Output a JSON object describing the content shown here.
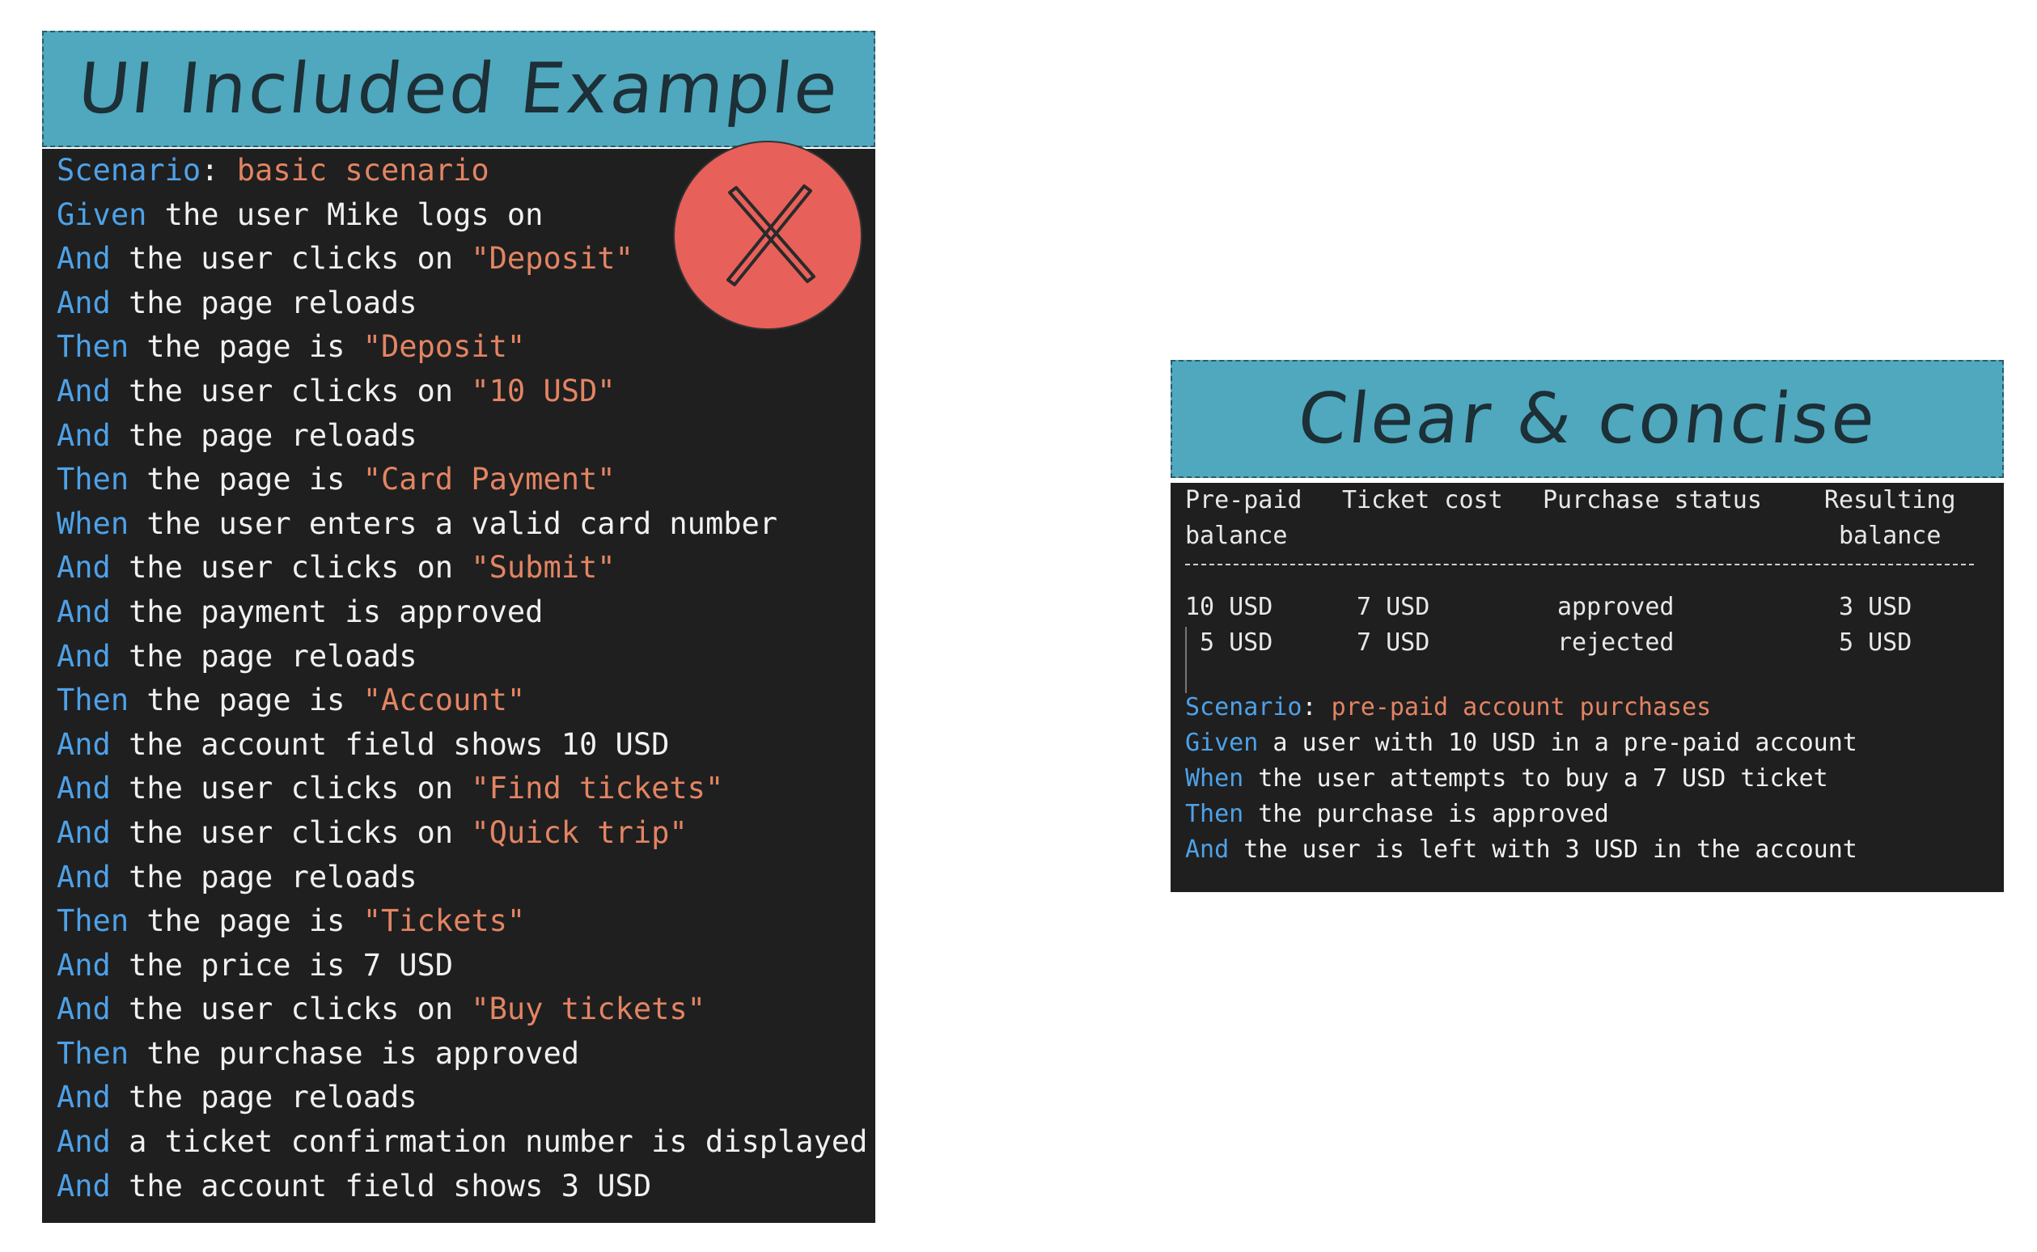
{
  "left": {
    "title": "UI Included Example",
    "lines": [
      [
        {
          "k": "kw",
          "t": "Scenario"
        },
        {
          "k": "txt",
          "t": ": "
        },
        {
          "k": "str",
          "t": "basic scenario"
        }
      ],
      [
        {
          "k": "kw",
          "t": "Given"
        },
        {
          "k": "txt",
          "t": " the user Mike logs on"
        }
      ],
      [
        {
          "k": "kw",
          "t": "And"
        },
        {
          "k": "txt",
          "t": " the user clicks on "
        },
        {
          "k": "str",
          "t": "\"Deposit\""
        }
      ],
      [
        {
          "k": "kw",
          "t": "And"
        },
        {
          "k": "txt",
          "t": " the page reloads"
        }
      ],
      [
        {
          "k": "kw",
          "t": "Then"
        },
        {
          "k": "txt",
          "t": " the page is "
        },
        {
          "k": "str",
          "t": "\"Deposit\""
        }
      ],
      [
        {
          "k": "kw",
          "t": "And"
        },
        {
          "k": "txt",
          "t": " the user clicks on "
        },
        {
          "k": "str",
          "t": "\"10 USD\""
        }
      ],
      [
        {
          "k": "kw",
          "t": "And"
        },
        {
          "k": "txt",
          "t": " the page reloads"
        }
      ],
      [
        {
          "k": "kw",
          "t": "Then"
        },
        {
          "k": "txt",
          "t": " the page is "
        },
        {
          "k": "str",
          "t": "\"Card Payment\""
        }
      ],
      [
        {
          "k": "kw",
          "t": "When"
        },
        {
          "k": "txt",
          "t": " the user enters a valid card number"
        }
      ],
      [
        {
          "k": "kw",
          "t": "And"
        },
        {
          "k": "txt",
          "t": " the user clicks on "
        },
        {
          "k": "str",
          "t": "\"Submit\""
        }
      ],
      [
        {
          "k": "kw",
          "t": "And"
        },
        {
          "k": "txt",
          "t": " the payment is approved"
        }
      ],
      [
        {
          "k": "kw",
          "t": "And"
        },
        {
          "k": "txt",
          "t": " the page reloads"
        }
      ],
      [
        {
          "k": "kw",
          "t": "Then"
        },
        {
          "k": "txt",
          "t": " the page is "
        },
        {
          "k": "str",
          "t": "\"Account\""
        }
      ],
      [
        {
          "k": "kw",
          "t": "And"
        },
        {
          "k": "txt",
          "t": " the account field shows 10 USD"
        }
      ],
      [
        {
          "k": "kw",
          "t": "And"
        },
        {
          "k": "txt",
          "t": " the user clicks on "
        },
        {
          "k": "str",
          "t": "\"Find tickets\""
        }
      ],
      [
        {
          "k": "kw",
          "t": "And"
        },
        {
          "k": "txt",
          "t": " the user clicks on "
        },
        {
          "k": "str",
          "t": "\"Quick trip\""
        }
      ],
      [
        {
          "k": "kw",
          "t": "And"
        },
        {
          "k": "txt",
          "t": " the page reloads"
        }
      ],
      [
        {
          "k": "kw",
          "t": "Then"
        },
        {
          "k": "txt",
          "t": " the page is "
        },
        {
          "k": "str",
          "t": "\"Tickets\""
        }
      ],
      [
        {
          "k": "kw",
          "t": "And"
        },
        {
          "k": "txt",
          "t": " the price is 7 USD"
        }
      ],
      [
        {
          "k": "kw",
          "t": "And"
        },
        {
          "k": "txt",
          "t": " the user clicks on "
        },
        {
          "k": "str",
          "t": "\"Buy tickets\""
        }
      ],
      [
        {
          "k": "kw",
          "t": "Then"
        },
        {
          "k": "txt",
          "t": " the purchase is approved"
        }
      ],
      [
        {
          "k": "kw",
          "t": "And"
        },
        {
          "k": "txt",
          "t": " the page reloads"
        }
      ],
      [
        {
          "k": "kw",
          "t": "And"
        },
        {
          "k": "txt",
          "t": " a ticket confirmation number is displayed"
        }
      ],
      [
        {
          "k": "kw",
          "t": "And"
        },
        {
          "k": "txt",
          "t": " the account field shows 3 USD"
        }
      ]
    ],
    "reject_icon": "x-icon"
  },
  "right": {
    "title": "Clear & concise",
    "table": {
      "headers": [
        {
          "line1": "Pre-paid",
          "line2": "balance"
        },
        {
          "line1": "Ticket cost",
          "line2": ""
        },
        {
          "line1": "Purchase status",
          "line2": ""
        },
        {
          "line1": "Resulting",
          "line2": "balance"
        }
      ],
      "rows": [
        [
          "10 USD",
          "7 USD",
          "approved",
          "3 USD"
        ],
        [
          "5 USD",
          "7 USD",
          "rejected",
          "5 USD"
        ]
      ]
    },
    "lines": [
      [
        {
          "k": "kw",
          "t": "Scenario"
        },
        {
          "k": "txt",
          "t": ": "
        },
        {
          "k": "str",
          "t": "pre-paid account purchases"
        }
      ],
      [
        {
          "k": "kw",
          "t": "Given"
        },
        {
          "k": "txt",
          "t": " a user with 10 USD in a pre-paid account"
        }
      ],
      [
        {
          "k": "kw",
          "t": "When"
        },
        {
          "k": "txt",
          "t": " the user attempts to buy a 7 USD ticket"
        }
      ],
      [
        {
          "k": "kw",
          "t": "Then"
        },
        {
          "k": "txt",
          "t": " the purchase is approved"
        }
      ],
      [
        {
          "k": "kw",
          "t": "And"
        },
        {
          "k": "txt",
          "t": " the user is left with 3 USD in the account"
        }
      ]
    ]
  },
  "colors": {
    "keyword": "#4ea1e8",
    "string": "#e38463",
    "text": "#f1f1f1",
    "panel": "#1f1f1f",
    "header": "#4fa8bd",
    "reject": "#e8605a"
  }
}
